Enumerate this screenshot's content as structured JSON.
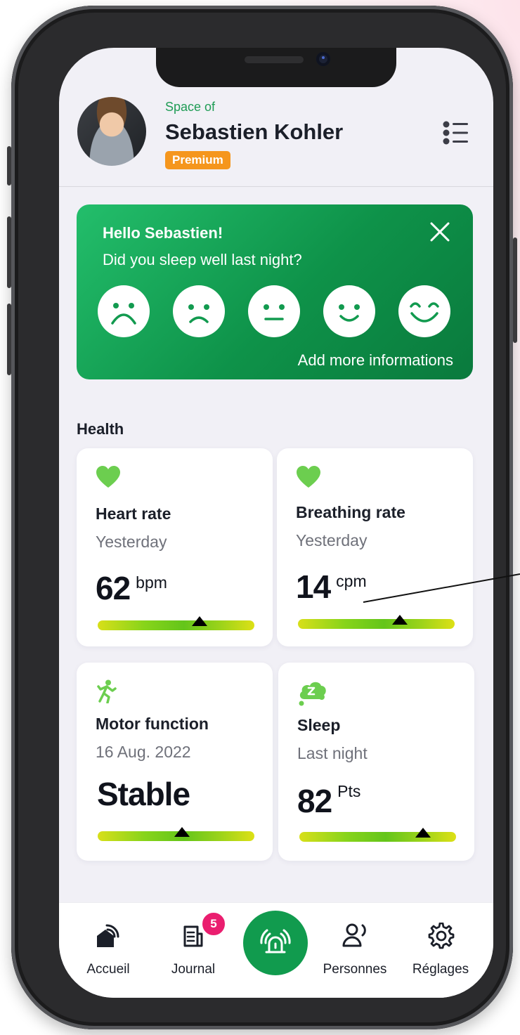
{
  "header": {
    "space_label": "Space of",
    "user_name": "Sebastien Kohler",
    "plan_badge": "Premium"
  },
  "greeting": {
    "title": "Hello Sebastien!",
    "question": "Did you sleep well last night?",
    "moods": [
      "very-sad",
      "sad",
      "neutral",
      "happy",
      "very-happy"
    ],
    "add_more": "Add more informations"
  },
  "health": {
    "section_title": "Health",
    "heart_rate": {
      "title": "Heart rate",
      "period": "Yesterday",
      "value": "62",
      "unit": "bpm",
      "gauge_level": 0.65
    },
    "breathing_rate": {
      "title": "Breathing rate",
      "period": "Yesterday",
      "value": "14",
      "unit": "cpm",
      "gauge_level": 0.65
    },
    "motor_function": {
      "title": "Motor function",
      "period": "16 Aug. 2022",
      "value": "Stable",
      "gauge_level": 0.54
    },
    "sleep": {
      "title": "Sleep",
      "period": "Last night",
      "value": "82",
      "unit": "Pts",
      "gauge_level": 0.79
    }
  },
  "nav": {
    "home": "Accueil",
    "journal": "Journal",
    "journal_badge": "5",
    "people": "Personnes",
    "settings": "Réglages"
  },
  "colors": {
    "brand_green": "#119b4e",
    "premium": "#f5961d",
    "heart_icon": "#6cce4f",
    "badge": "#ea1e6f"
  },
  "icons": [
    "menu-icon",
    "close-icon",
    "heart-icon",
    "running-person-icon",
    "sleep-cloud-icon",
    "home-wifi-icon",
    "journal-icon",
    "alarm-icon",
    "people-icon",
    "gear-icon"
  ]
}
